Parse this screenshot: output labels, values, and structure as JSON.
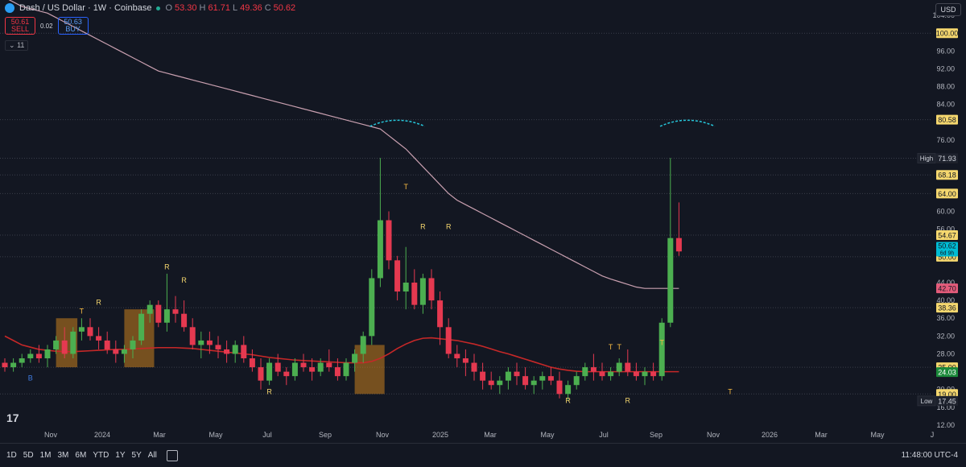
{
  "header": {
    "title": "Dash / US Dollar · 1W · Coinbase",
    "ohlc": [
      {
        "label": "O",
        "value": "53.30"
      },
      {
        "label": "H",
        "value": "61.71"
      },
      {
        "label": "L",
        "value": "49.36"
      },
      {
        "label": "C",
        "value": "50.62"
      }
    ],
    "status_color": "#22ab94"
  },
  "trade": {
    "sell_price": "50.61",
    "sell_label": "SELL",
    "spread": "0.02",
    "buy_price": "50.63",
    "buy_label": "BUY"
  },
  "indicator_toggle": "11",
  "currency": "USD",
  "price_axis": {
    "ticks": [
      "104.00",
      "96.00",
      "92.00",
      "88.00",
      "84.00",
      "76.00",
      "60.00",
      "56.00",
      "52.00",
      "44.00",
      "40.00",
      "36.00",
      "32.00",
      "28.00",
      "20.00",
      "16.00",
      "12.00"
    ],
    "tags": [
      {
        "text": "100.00",
        "value": 100,
        "bg": "#f5d76e",
        "fg": "#131722"
      },
      {
        "text": "80.58",
        "value": 80.58,
        "bg": "#f5d76e",
        "fg": "#131722"
      },
      {
        "text": "71.93",
        "value": 71.93,
        "bg": "#f5d76e",
        "fg": "#131722"
      },
      {
        "text": "68.18",
        "value": 68.18,
        "bg": "#f5d76e",
        "fg": "#131722"
      },
      {
        "text": "64.00",
        "value": 64,
        "bg": "#f5d76e",
        "fg": "#131722"
      },
      {
        "text": "54.67",
        "value": 54.67,
        "bg": "#f5d76e",
        "fg": "#131722"
      },
      {
        "text": "50.00",
        "value": 49.8,
        "bg": "#f5d76e",
        "fg": "#131722"
      },
      {
        "text": "42.70",
        "value": 42.7,
        "bg": "#e35b7a",
        "fg": "#131722"
      },
      {
        "text": "38.36",
        "value": 38.36,
        "bg": "#f5d76e",
        "fg": "#131722"
      },
      {
        "text": "25.00",
        "value": 25,
        "bg": "#f5d76e",
        "fg": "#131722"
      },
      {
        "text": "24.03",
        "value": 23.9,
        "bg": "#1b8a3a",
        "fg": "#ffffff"
      },
      {
        "text": "19.00",
        "value": 19,
        "bg": "#f5d76e",
        "fg": "#131722"
      }
    ],
    "current": {
      "price": "50.62",
      "countdown": "6d 9h",
      "value": 51.5,
      "bg": "#00bcd4"
    },
    "high": {
      "label": "High",
      "value_text": "71.93",
      "value": 71.93
    },
    "low": {
      "label": "Low",
      "value_text": "17.45",
      "value": 17.45
    }
  },
  "time_axis": [
    "Nov",
    "2024",
    "Mar",
    "May",
    "Jul",
    "Sep",
    "Nov",
    "2025",
    "Mar",
    "May",
    "Jul",
    "Sep",
    "Nov",
    "2026",
    "Mar",
    "May",
    "J"
  ],
  "timeframes": [
    "1D",
    "5D",
    "1M",
    "3M",
    "6M",
    "YTD",
    "1Y",
    "5Y",
    "All"
  ],
  "clock": "11:48:00 UTC-4",
  "chart_data": {
    "type": "candlestick",
    "ylim": [
      12,
      106
    ],
    "x_start": "2023-10-16",
    "x_interval": "1W",
    "markers": [
      "B",
      "T",
      "R",
      "R",
      "R",
      "T",
      "R",
      "R",
      "T",
      "T",
      "R",
      "R",
      "T",
      "R",
      "T"
    ],
    "candles": [
      [
        26,
        27,
        24,
        25
      ],
      [
        25,
        27,
        24,
        26
      ],
      [
        26,
        28,
        25,
        27
      ],
      [
        27,
        29,
        26,
        28
      ],
      [
        28,
        30,
        26,
        27
      ],
      [
        27,
        30,
        25,
        29
      ],
      [
        29,
        32,
        28,
        31
      ],
      [
        31,
        34,
        27,
        28
      ],
      [
        28,
        34,
        27,
        33
      ],
      [
        33,
        36,
        31,
        34
      ],
      [
        34,
        36,
        31,
        32
      ],
      [
        32,
        34,
        29,
        31
      ],
      [
        31,
        33,
        28,
        29
      ],
      [
        29,
        31,
        26,
        28
      ],
      [
        28,
        30,
        26,
        29
      ],
      [
        29,
        32,
        27,
        31
      ],
      [
        31,
        38,
        30,
        37
      ],
      [
        37,
        40,
        35,
        39
      ],
      [
        39,
        40,
        34,
        35
      ],
      [
        35,
        46,
        33,
        38
      ],
      [
        38,
        41,
        35,
        37
      ],
      [
        37,
        40,
        33,
        34
      ],
      [
        34,
        36,
        29,
        30
      ],
      [
        30,
        33,
        27,
        31
      ],
      [
        31,
        33,
        28,
        30
      ],
      [
        30,
        32,
        27,
        29
      ],
      [
        29,
        31,
        26,
        28
      ],
      [
        28,
        31,
        26,
        30
      ],
      [
        30,
        32,
        26,
        27
      ],
      [
        27,
        29,
        24,
        25
      ],
      [
        25,
        27,
        20,
        22
      ],
      [
        22,
        27,
        21,
        26
      ],
      [
        26,
        28,
        23,
        24
      ],
      [
        24,
        25,
        21,
        23
      ],
      [
        23,
        27,
        22,
        26
      ],
      [
        26,
        28,
        24,
        25
      ],
      [
        25,
        27,
        22,
        24
      ],
      [
        24,
        27,
        23,
        26
      ],
      [
        26,
        29,
        24,
        25
      ],
      [
        25,
        27,
        22,
        23
      ],
      [
        23,
        27,
        22,
        26
      ],
      [
        26,
        29,
        24,
        28
      ],
      [
        28,
        33,
        26,
        32
      ],
      [
        32,
        47,
        30,
        45
      ],
      [
        45,
        72,
        43,
        58
      ],
      [
        58,
        60,
        47,
        49
      ],
      [
        49,
        50,
        40,
        42
      ],
      [
        42,
        52,
        38,
        44
      ],
      [
        44,
        47,
        38,
        39
      ],
      [
        39,
        46,
        37,
        45
      ],
      [
        45,
        47,
        38,
        40
      ],
      [
        40,
        42,
        30,
        34
      ],
      [
        34,
        36,
        27,
        28
      ],
      [
        28,
        30,
        25,
        27
      ],
      [
        27,
        29,
        23,
        26
      ],
      [
        26,
        28,
        22,
        24
      ],
      [
        24,
        26,
        20,
        22
      ],
      [
        22,
        24,
        20,
        21
      ],
      [
        21,
        23,
        19,
        22
      ],
      [
        22,
        25,
        20,
        24
      ],
      [
        24,
        26,
        21,
        23
      ],
      [
        23,
        25,
        20,
        21
      ],
      [
        21,
        23,
        19,
        22
      ],
      [
        22,
        24,
        20,
        23
      ],
      [
        23,
        25,
        21,
        22
      ],
      [
        22,
        24,
        18,
        19
      ],
      [
        19,
        22,
        17.5,
        21
      ],
      [
        21,
        24,
        20,
        23
      ],
      [
        23,
        26,
        22,
        25
      ],
      [
        25,
        28,
        22,
        24
      ],
      [
        24,
        26,
        22,
        23
      ],
      [
        23,
        25,
        22,
        24
      ],
      [
        24,
        27,
        23,
        26
      ],
      [
        26,
        29,
        23,
        24
      ],
      [
        24,
        26,
        22,
        23
      ],
      [
        23,
        25,
        21,
        24
      ],
      [
        24,
        26,
        22,
        23
      ],
      [
        23,
        36,
        22,
        35
      ],
      [
        35,
        72,
        34,
        54
      ],
      [
        54,
        62,
        50,
        51
      ]
    ],
    "ma_long": [
      108,
      107,
      106,
      105.5,
      105,
      104.5,
      103.5,
      102.5,
      101.5,
      100.5,
      99.5,
      98.5,
      97.5,
      96.5,
      95.5,
      94.5,
      93.5,
      92.5,
      91.5,
      91,
      90.5,
      90,
      89.5,
      89,
      88.5,
      88,
      87.5,
      87,
      86.5,
      86,
      85.5,
      85,
      84.5,
      84,
      83.5,
      83,
      82.5,
      82,
      81.5,
      81,
      80.5,
      80,
      79.5,
      79,
      78.5,
      77,
      75.5,
      74,
      72,
      70,
      68,
      66,
      64,
      62.5,
      61.5,
      60.5,
      59.5,
      58.5,
      57.5,
      56.5,
      55.5,
      54.5,
      53.5,
      52.5,
      51.5,
      50.5,
      49.5,
      48.5,
      47.5,
      46.5,
      45.5,
      44.8,
      44.2,
      43.6,
      43,
      42.7,
      42.7,
      42.7,
      42.7,
      42.7
    ],
    "ma_short": [
      32,
      31,
      30,
      29.5,
      29,
      28.8,
      28.6,
      28.5,
      28.5,
      28.6,
      28.7,
      28.8,
      28.9,
      29,
      29,
      29.1,
      29.2,
      29.3,
      29.4,
      29.4,
      29.4,
      29.3,
      29.2,
      29,
      28.8,
      28.6,
      28.4,
      28.2,
      28,
      27.8,
      27.5,
      27.2,
      27,
      26.8,
      26.6,
      26.5,
      26.4,
      26.3,
      26.2,
      26.1,
      26,
      26,
      26,
      26.3,
      27,
      28,
      29.2,
      30.2,
      31,
      31.5,
      31.6,
      31.4,
      31.2,
      31,
      30.6,
      30.2,
      29.7,
      29.1,
      28.5,
      28,
      27.4,
      26.8,
      26.2,
      25.6,
      25,
      24.6,
      24.3,
      24.1,
      24,
      24,
      24,
      24,
      24,
      24,
      24,
      24,
      24,
      24,
      24,
      24
    ]
  }
}
